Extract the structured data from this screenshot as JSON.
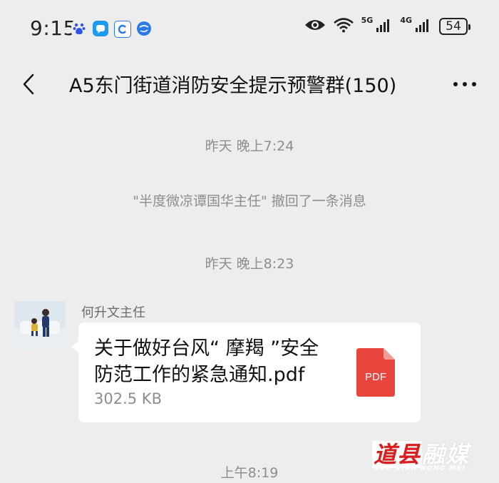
{
  "status_bar": {
    "time": "9:15",
    "network_1": "5G",
    "network_2": "4G",
    "battery": "54"
  },
  "header": {
    "title": "A5东门街道消防安全提示预警群(150)"
  },
  "messages": {
    "ts1": "昨天 晚上7:24",
    "recall": "\"半度微凉谭国华主任\" 撤回了一条消息",
    "ts2": "昨天 晚上8:23",
    "sender": "何升文主任",
    "file_name": "关于做好台风“ 摩羯 ”安全防范工作的紧急通知.pdf",
    "file_size": "302.5 KB",
    "file_type": "PDF",
    "ts3": "上午8:19"
  },
  "watermark": {
    "main_a": "道县",
    "main_b": "融媒",
    "sub": "DAO XIAN RONG MEI"
  },
  "colors": {
    "background": "#ededed",
    "pdf_red": "#e8453c",
    "bubble": "#ffffff"
  }
}
